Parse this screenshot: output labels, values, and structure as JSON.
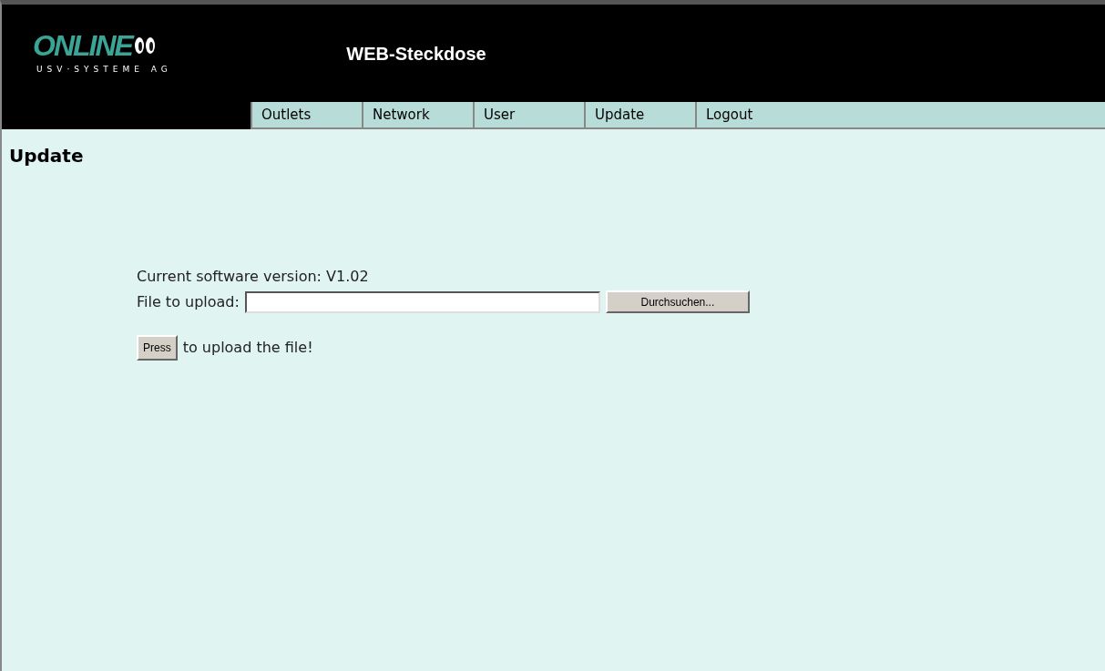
{
  "header": {
    "logo": {
      "wordmark": "ONLINE",
      "tagline": "USV·SYSTEME AG"
    },
    "title": "WEB-Steckdose"
  },
  "nav": [
    "Outlets",
    "Network",
    "User",
    "Update",
    "Logout"
  ],
  "page": {
    "heading": "Update",
    "version_line": "Current software version: V1.02",
    "file_label": "File to upload:",
    "browse_button": "Durchsuchen...",
    "submit_button": "Press",
    "submit_hint": "to upload the file!"
  }
}
